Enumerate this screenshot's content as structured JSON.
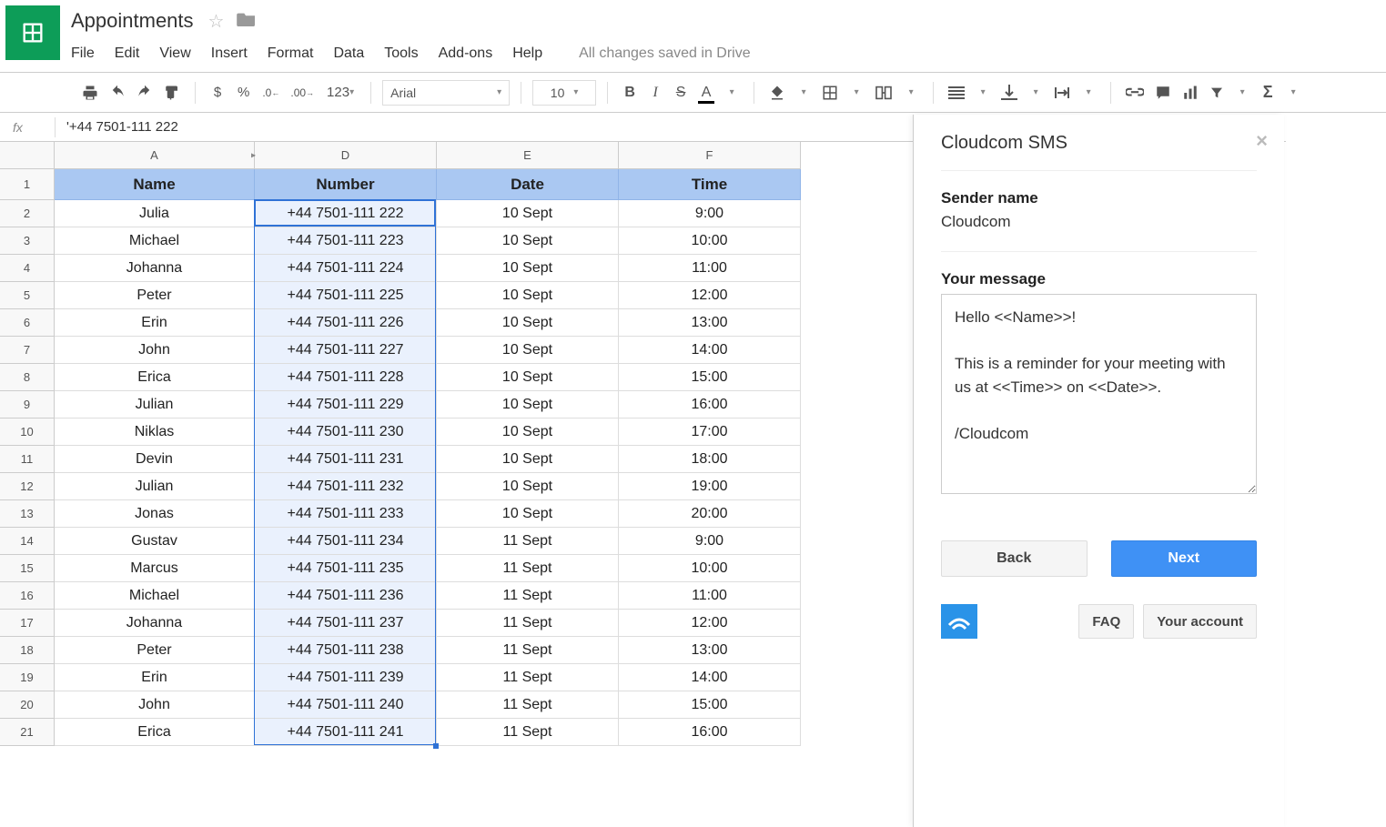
{
  "header": {
    "doc_title": "Appointments",
    "menu": [
      "File",
      "Edit",
      "View",
      "Insert",
      "Format",
      "Data",
      "Tools",
      "Add-ons",
      "Help"
    ],
    "save_status": "All changes saved in Drive"
  },
  "toolbar": {
    "currency": "$",
    "percent": "%",
    "dec_decrease": ".0←",
    "dec_increase": ".00→",
    "num_format": "123",
    "font_name": "Arial",
    "font_size": "10",
    "bold": "B",
    "italic": "I",
    "strike": "S",
    "text_color": "A"
  },
  "formula_bar": {
    "fx_label": "fx",
    "content": "'+44 7501-111 222"
  },
  "grid": {
    "columns": [
      "A",
      "D",
      "E",
      "F"
    ],
    "header_row": {
      "A": "Name",
      "D": "Number",
      "E": "Date",
      "F": "Time"
    },
    "rows": [
      {
        "n": "2",
        "A": "Julia",
        "D": "+44 7501-111 222",
        "E": "10 Sept",
        "F": "9:00"
      },
      {
        "n": "3",
        "A": "Michael",
        "D": "+44 7501-111 223",
        "E": "10 Sept",
        "F": "10:00"
      },
      {
        "n": "4",
        "A": "Johanna",
        "D": "+44 7501-111 224",
        "E": "10 Sept",
        "F": "11:00"
      },
      {
        "n": "5",
        "A": "Peter",
        "D": "+44 7501-111 225",
        "E": "10 Sept",
        "F": "12:00"
      },
      {
        "n": "6",
        "A": "Erin",
        "D": "+44 7501-111 226",
        "E": "10 Sept",
        "F": "13:00"
      },
      {
        "n": "7",
        "A": "John",
        "D": "+44 7501-111 227",
        "E": "10 Sept",
        "F": "14:00"
      },
      {
        "n": "8",
        "A": "Erica",
        "D": "+44 7501-111 228",
        "E": "10 Sept",
        "F": "15:00"
      },
      {
        "n": "9",
        "A": "Julian",
        "D": "+44 7501-111 229",
        "E": "10 Sept",
        "F": "16:00"
      },
      {
        "n": "10",
        "A": "Niklas",
        "D": "+44 7501-111 230",
        "E": "10 Sept",
        "F": "17:00"
      },
      {
        "n": "11",
        "A": "Devin",
        "D": "+44 7501-111 231",
        "E": "10 Sept",
        "F": "18:00"
      },
      {
        "n": "12",
        "A": "Julian",
        "D": "+44 7501-111 232",
        "E": "10 Sept",
        "F": "19:00"
      },
      {
        "n": "13",
        "A": "Jonas",
        "D": "+44 7501-111 233",
        "E": "10 Sept",
        "F": "20:00"
      },
      {
        "n": "14",
        "A": "Gustav",
        "D": "+44 7501-111 234",
        "E": "11 Sept",
        "F": "9:00"
      },
      {
        "n": "15",
        "A": "Marcus",
        "D": "+44 7501-111 235",
        "E": "11 Sept",
        "F": "10:00"
      },
      {
        "n": "16",
        "A": "Michael",
        "D": "+44 7501-111 236",
        "E": "11 Sept",
        "F": "11:00"
      },
      {
        "n": "17",
        "A": "Johanna",
        "D": "+44 7501-111 237",
        "E": "11 Sept",
        "F": "12:00"
      },
      {
        "n": "18",
        "A": "Peter",
        "D": "+44 7501-111 238",
        "E": "11 Sept",
        "F": "13:00"
      },
      {
        "n": "19",
        "A": "Erin",
        "D": "+44 7501-111 239",
        "E": "11 Sept",
        "F": "14:00"
      },
      {
        "n": "20",
        "A": "John",
        "D": "+44 7501-111 240",
        "E": "11 Sept",
        "F": "15:00"
      },
      {
        "n": "21",
        "A": "Erica",
        "D": "+44 7501-111 241",
        "E": "11 Sept",
        "F": "16:00"
      }
    ],
    "active_cell": {
      "row": 0,
      "col": "D"
    },
    "selected_column": "D"
  },
  "sidebar": {
    "title": "Cloudcom SMS",
    "sender_label": "Sender name",
    "sender_value": "Cloudcom",
    "message_label": "Your message",
    "message_value": "Hello <<Name>>!\n\nThis is a reminder for your meeting with us at <<Time>> on <<Date>>.\n\n/Cloudcom",
    "back_label": "Back",
    "next_label": "Next",
    "faq_label": "FAQ",
    "account_label": "Your account"
  }
}
